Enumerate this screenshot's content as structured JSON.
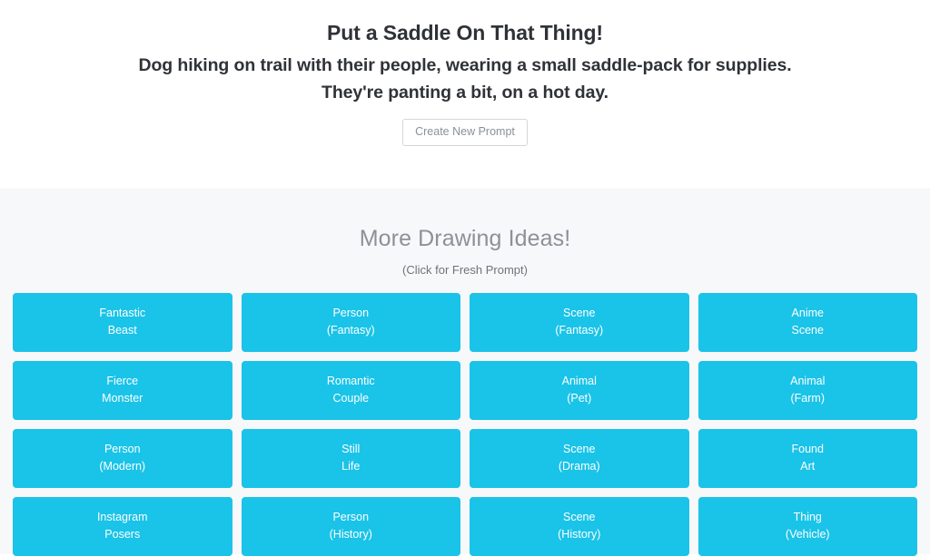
{
  "prompt": {
    "title": "Put a Saddle On That Thing!",
    "description_line_1": "Dog hiking on trail with their people, wearing a small saddle-pack for supplies.",
    "description_line_2": "They're panting a bit, on a hot day.",
    "new_prompt_button_label": "Create New Prompt"
  },
  "ideas": {
    "heading": "More Drawing Ideas!",
    "subheading": "(Click for Fresh Prompt)",
    "tiles": [
      {
        "line1": "Fantastic",
        "line2": "Beast"
      },
      {
        "line1": "Person",
        "line2": "(Fantasy)"
      },
      {
        "line1": "Scene",
        "line2": "(Fantasy)"
      },
      {
        "line1": "Anime",
        "line2": "Scene"
      },
      {
        "line1": "Fierce",
        "line2": "Monster"
      },
      {
        "line1": "Romantic",
        "line2": "Couple"
      },
      {
        "line1": "Animal",
        "line2": "(Pet)"
      },
      {
        "line1": "Animal",
        "line2": "(Farm)"
      },
      {
        "line1": "Person",
        "line2": "(Modern)"
      },
      {
        "line1": "Still",
        "line2": "Life"
      },
      {
        "line1": "Scene",
        "line2": "(Drama)"
      },
      {
        "line1": "Found",
        "line2": "Art"
      },
      {
        "line1": "Instagram",
        "line2": "Posers"
      },
      {
        "line1": "Person",
        "line2": "(History)"
      },
      {
        "line1": "Scene",
        "line2": "(History)"
      },
      {
        "line1": "Thing",
        "line2": "(Vehicle)"
      }
    ]
  },
  "colors": {
    "tile_background": "#1ac3e8",
    "tile_text": "#ffffff",
    "page_background": "#ffffff",
    "section_background": "#f7f8fa",
    "title_text": "#2f3237",
    "heading_text": "#8d9196",
    "button_border": "#d4d6d9",
    "button_text": "#8b9096"
  }
}
